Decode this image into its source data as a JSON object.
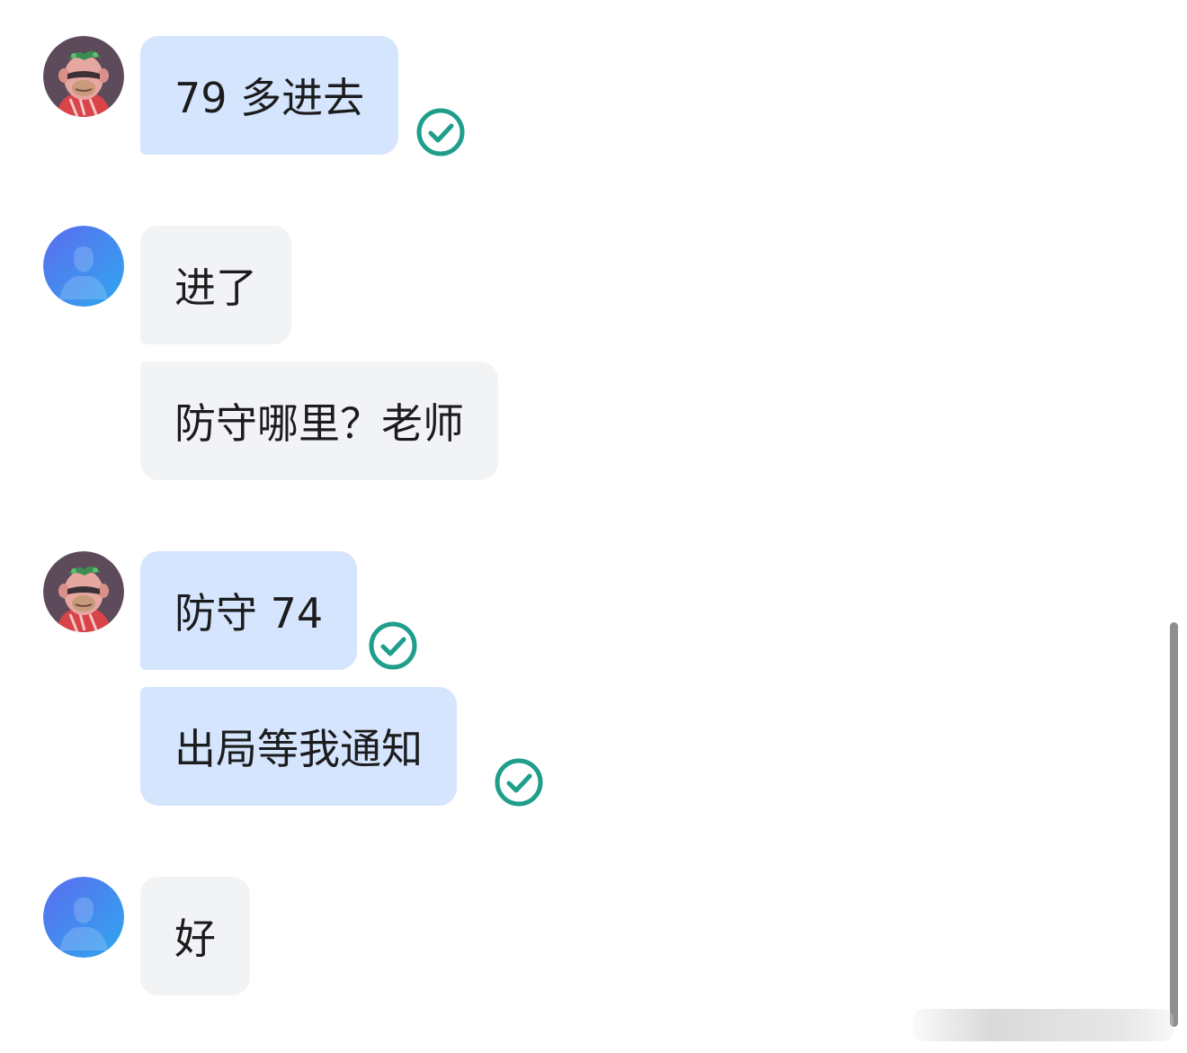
{
  "messages": [
    {
      "sender": "me",
      "text": "79 多进去",
      "status": "sent-check-icon"
    },
    {
      "sender": "them",
      "text": "进了"
    },
    {
      "sender": "them",
      "text": "防守哪里？老师"
    },
    {
      "sender": "me",
      "text": "防守 74",
      "status": "sent-check-icon"
    },
    {
      "sender": "me",
      "text": "出局等我通知",
      "status": "sent-check-icon"
    },
    {
      "sender": "them",
      "text": "好"
    }
  ],
  "colors": {
    "my_bubble": "#d5e5fd",
    "their_bubble": "#f2f3f5",
    "check": "#1f9e8c",
    "default_avatar_start": "#5b6df0",
    "default_avatar_end": "#2fa7ee"
  }
}
